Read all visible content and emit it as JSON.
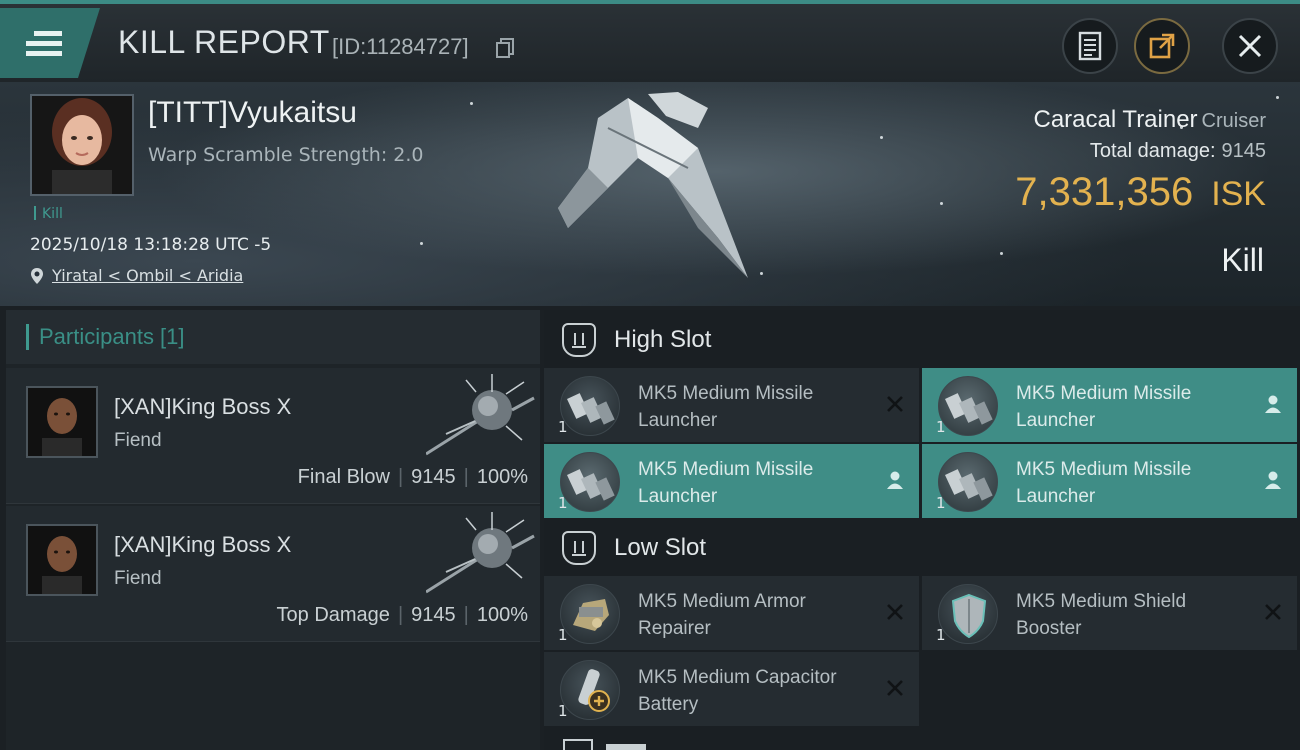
{
  "header": {
    "title": "KILL REPORT",
    "report_id": "[ID:11284727]",
    "icons": {
      "menu": "menu-icon",
      "copy": "copy-icon",
      "log": "document-icon",
      "share": "share-icon",
      "close": "close-icon"
    }
  },
  "victim": {
    "name": "[TITT]Vyukaitsu",
    "warp_scramble": "Warp Scramble Strength: 2.0",
    "tag": "Kill",
    "datetime": "2025/10/18 13:18:28 UTC -5",
    "location": "Yiratal < Ombil < Aridia"
  },
  "ship": {
    "name": "Caracal Trainer",
    "class": "Cruiser",
    "total_damage_label": "Total damage:",
    "total_damage": "9145",
    "isk_value": "7,331,356",
    "isk_unit": "ISK",
    "result": "Kill"
  },
  "participants": {
    "header": "Participants [1]",
    "rows": [
      {
        "name": "[XAN]King Boss X",
        "ship": "Fiend",
        "role": "Final Blow",
        "damage": "9145",
        "percent": "100%"
      },
      {
        "name": "[XAN]King Boss X",
        "ship": "Fiend",
        "role": "Top Damage",
        "damage": "9145",
        "percent": "100%"
      }
    ]
  },
  "slots": {
    "high": {
      "label": "High Slot",
      "modules": [
        {
          "name": "MK5 Medium Missile Launcher",
          "qty": "1",
          "state": "destroyed",
          "icon": "missile-launcher-icon"
        },
        {
          "name": "MK5 Medium Missile Launcher",
          "qty": "1",
          "state": "dropped",
          "icon": "missile-launcher-icon"
        },
        {
          "name": "MK5 Medium Missile Launcher",
          "qty": "1",
          "state": "dropped",
          "icon": "missile-launcher-icon"
        },
        {
          "name": "MK5 Medium Missile Launcher",
          "qty": "1",
          "state": "dropped",
          "icon": "missile-launcher-icon"
        }
      ]
    },
    "low": {
      "label": "Low Slot",
      "modules": [
        {
          "name": "MK5 Medium Armor Repairer",
          "qty": "1",
          "state": "destroyed",
          "icon": "armor-repairer-icon"
        },
        {
          "name": "MK5 Medium Shield Booster",
          "qty": "1",
          "state": "destroyed",
          "icon": "shield-booster-icon"
        },
        {
          "name": "MK5 Medium Capacitor Battery",
          "qty": "1",
          "state": "destroyed",
          "icon": "capacitor-battery-icon"
        }
      ]
    }
  },
  "colors": {
    "accent": "#3f8d86",
    "isk": "#e3b24f"
  }
}
